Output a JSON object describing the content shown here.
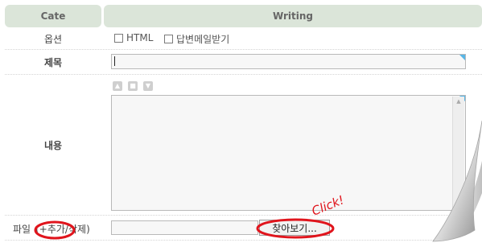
{
  "header": {
    "cate": "Cate",
    "writing": "Writing"
  },
  "options": {
    "label": "옵션",
    "html": "HTML",
    "reply_email": "답변메일받기"
  },
  "title_row": {
    "label": "제목",
    "value": ""
  },
  "content_row": {
    "label": "내용",
    "value": ""
  },
  "file_row": {
    "label": "파일",
    "open_paren": "(",
    "add": "+추가",
    "separator": "/",
    "delete": "삭제",
    "close_paren": ")",
    "file_value": "",
    "browse": "찾아보기..."
  },
  "annotation": {
    "text": "Click!",
    "color": "#e0141c"
  },
  "colors": {
    "header_bg": "#dbe5d9",
    "accent_corner": "#58b6e6",
    "highlight": "#e0141c"
  }
}
